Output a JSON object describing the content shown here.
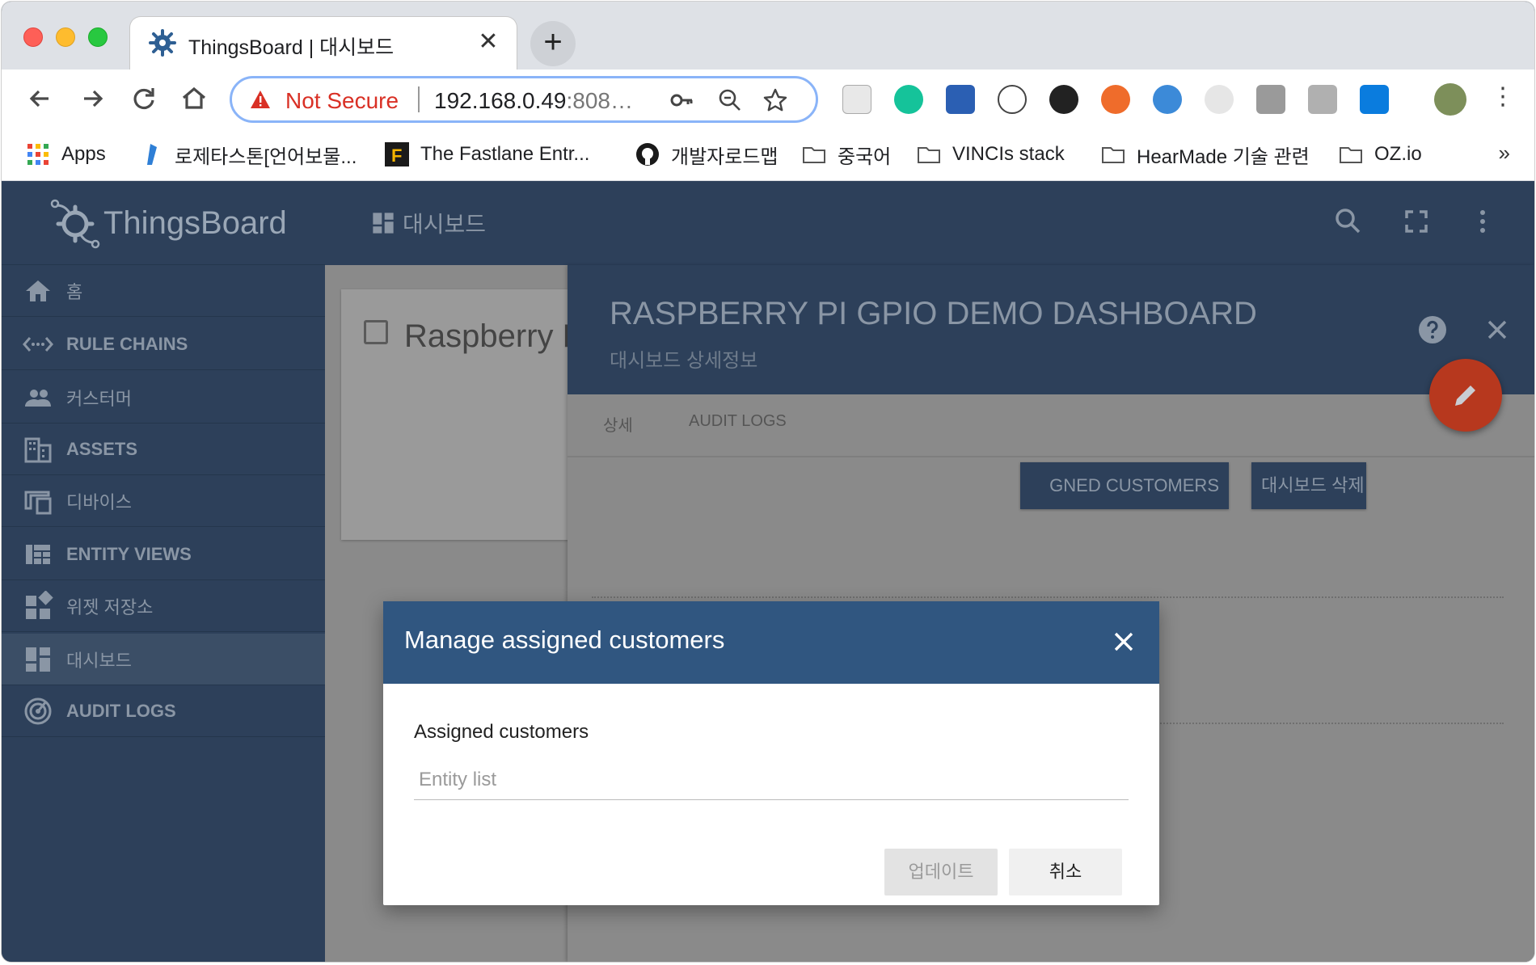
{
  "browser": {
    "tab_title": "ThingsBoard | 대시보드",
    "security_label": "Not Secure",
    "url_main": "192.168.0.49",
    "url_dim": ":808…",
    "bookmarks": [
      {
        "label": "Apps",
        "icon": "apps-grid-icon"
      },
      {
        "label": "로제타스톤[언어보물...",
        "icon": "rosetta-stone-icon"
      },
      {
        "label": "The Fastlane Entr...",
        "icon": "fastlane-icon"
      },
      {
        "label": "개발자로드맵",
        "icon": "github-icon"
      },
      {
        "label": "중국어",
        "icon": "folder-icon"
      },
      {
        "label": "VINCIs stack",
        "icon": "folder-icon"
      },
      {
        "label": "HearMade 기술 관련",
        "icon": "folder-icon"
      },
      {
        "label": "OZ.io",
        "icon": "folder-icon"
      }
    ]
  },
  "app": {
    "logo_text": "ThingsBoard",
    "breadcrumb": "대시보드",
    "menu": [
      {
        "label": "홈",
        "icon": "home-icon"
      },
      {
        "label": "RULE CHAINS",
        "icon": "rule-chains-icon"
      },
      {
        "label": "커스터머",
        "icon": "customers-icon"
      },
      {
        "label": "ASSETS",
        "icon": "assets-icon"
      },
      {
        "label": "디바이스",
        "icon": "devices-icon"
      },
      {
        "label": "ENTITY VIEWS",
        "icon": "entity-views-icon"
      },
      {
        "label": "위젯 저장소",
        "icon": "widgets-icon"
      },
      {
        "label": "대시보드",
        "icon": "dashboard-icon",
        "active": true
      },
      {
        "label": "AUDIT LOGS",
        "icon": "audit-logs-icon"
      }
    ],
    "card_title": "Raspberry P",
    "detail": {
      "title": "RASPBERRY PI GPIO DEMO DASHBOARD",
      "subtitle": "대시보드 상세정보",
      "tabs": [
        "상세",
        "AUDIT LOGS"
      ],
      "assign_button": "GNED CUSTOMERS",
      "delete_button": "대시보드 삭제"
    }
  },
  "dialog": {
    "title": "Manage assigned customers",
    "field_label": "Assigned customers",
    "field_placeholder": "Entity list",
    "update_button": "업데이트",
    "cancel_button": "취소"
  },
  "colors": {
    "primary": "#305680",
    "sidebar": "#2d405a",
    "fab": "#b7381e",
    "warning": "#d93025"
  }
}
